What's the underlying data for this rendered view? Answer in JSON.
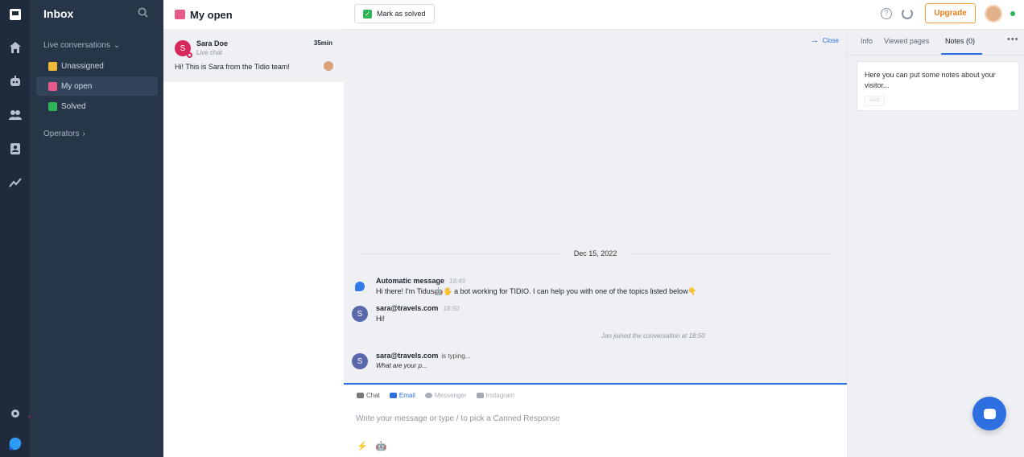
{
  "nav": {
    "title": "Inbox",
    "live_conversations": "Live conversations",
    "items": [
      {
        "label": "Unassigned",
        "emoji_color": "#f0b93a"
      },
      {
        "label": "My open",
        "emoji_color": "#e65b8c"
      },
      {
        "label": "Solved",
        "emoji_color": "#2fb457"
      }
    ],
    "operators": "Operators"
  },
  "list": {
    "title": "My open",
    "conversation": {
      "initial": "S",
      "name": "Sara Doe",
      "channel": "Live chat",
      "time": "35min",
      "preview": "Hi! This is Sara from the Tidio team!"
    }
  },
  "topbar": {
    "mark_solved": "Mark as solved",
    "help_glyph": "?",
    "upgrade": "Upgrade"
  },
  "chat": {
    "close": "Close",
    "date": "Dec 15, 2022",
    "messages": [
      {
        "author": "Automatic message",
        "time": "18:49",
        "text": "Hi there! I'm Tidus🤖🖐 a bot working for TIDIO. I can help you with one of the topics listed below👇"
      },
      {
        "initial": "S",
        "author": "sara@travels.com",
        "time": "18:50",
        "text": "Hi!"
      },
      {
        "initial": "S",
        "author": "sara@travels.com",
        "typing": "is typing...",
        "text": "What are your p..."
      }
    ],
    "system": "Jan joined the conversation at 18:50"
  },
  "composer": {
    "channels": [
      "Chat",
      "Email",
      "Messenger",
      "Instagram"
    ],
    "placeholder": "Write your message or type / to pick a Canned Response",
    "tool_lightning": "⚡",
    "tool_bot": "🤖"
  },
  "side": {
    "tabs": [
      "Info",
      "Viewed pages",
      "Notes (0)"
    ],
    "note_text": "Here you can put some notes about your visitor...",
    "note_button": "ADD"
  },
  "colors": {
    "accent": "#2d6fe0",
    "upgrade": "#e87e1b",
    "success": "#2fb457",
    "avatar": "#d6285b"
  }
}
